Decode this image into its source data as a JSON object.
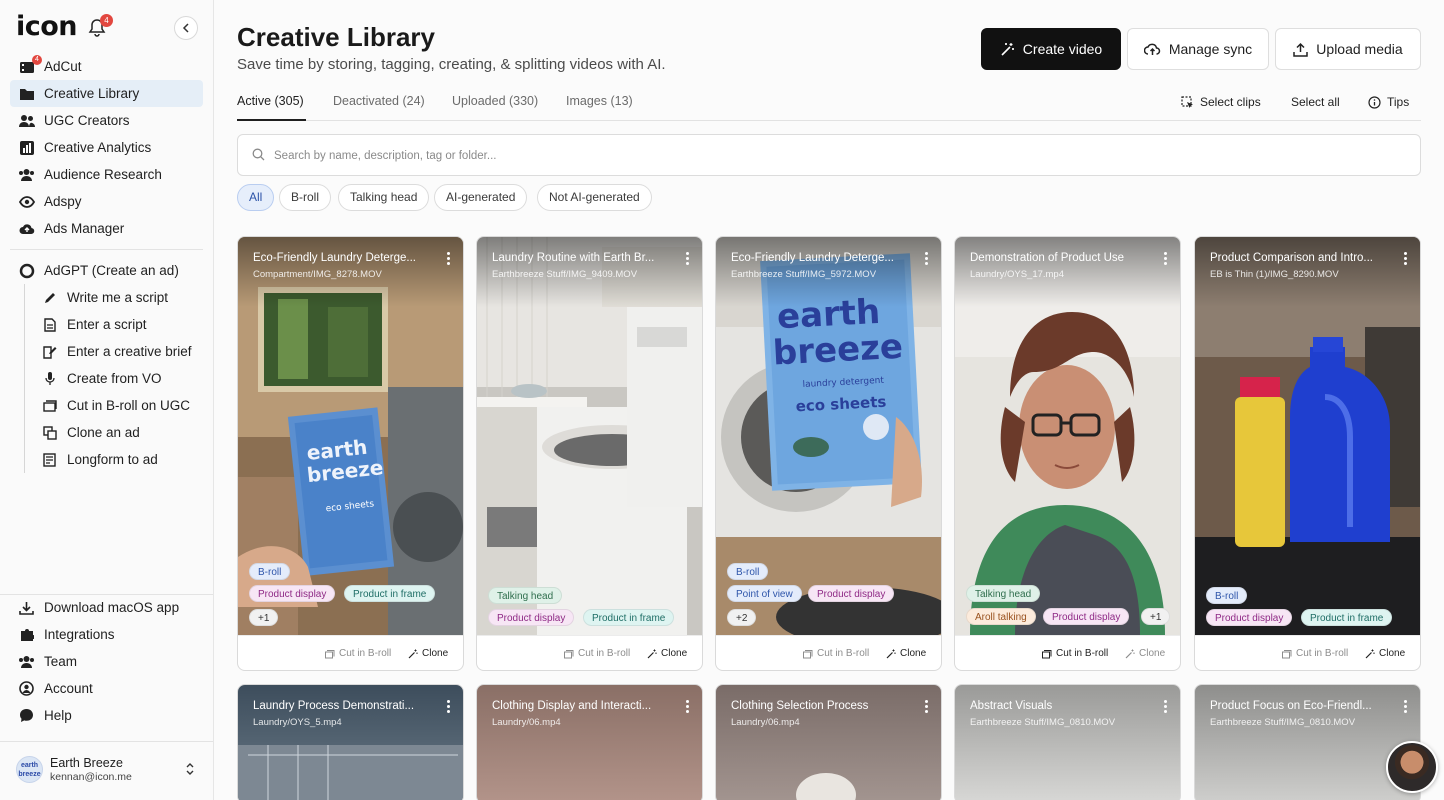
{
  "app": {
    "logo": "icon",
    "bell_badge": "4"
  },
  "sidebar": {
    "items": [
      {
        "label": "AdCut",
        "icon": "film-icon",
        "badge": "4"
      },
      {
        "label": "Creative Library",
        "icon": "folder-icon",
        "active": true
      },
      {
        "label": "UGC Creators",
        "icon": "users-icon"
      },
      {
        "label": "Creative Analytics",
        "icon": "bar-chart-icon"
      },
      {
        "label": "Audience Research",
        "icon": "audience-icon"
      },
      {
        "label": "Adspy",
        "icon": "eye-icon"
      },
      {
        "label": "Ads Manager",
        "icon": "cloud-upload-icon"
      }
    ],
    "adgpt": {
      "label": "AdGPT (Create an ad)",
      "icon": "ring-icon"
    },
    "sub_items": [
      {
        "label": "Write me a script",
        "icon": "pencil-icon"
      },
      {
        "label": "Enter a script",
        "icon": "document-icon"
      },
      {
        "label": "Enter a creative brief",
        "icon": "edit-doc-icon"
      },
      {
        "label": "Create from VO",
        "icon": "microphone-icon"
      },
      {
        "label": "Cut in B-roll on UGC",
        "icon": "media-stack-icon"
      },
      {
        "label": "Clone an ad",
        "icon": "copy-icon"
      },
      {
        "label": "Longform to ad",
        "icon": "longform-icon"
      }
    ],
    "bottom": [
      {
        "label": "Download macOS app",
        "icon": "download-icon"
      },
      {
        "label": "Integrations",
        "icon": "puzzle-icon"
      },
      {
        "label": "Team",
        "icon": "team-icon"
      },
      {
        "label": "Account",
        "icon": "account-icon"
      },
      {
        "label": "Help",
        "icon": "chat-icon"
      }
    ],
    "user": {
      "name": "Earth Breeze",
      "email": "kennan@icon.me",
      "avatar_text": "earth breeze"
    }
  },
  "header": {
    "title": "Creative Library",
    "subtitle": "Save time by storing, tagging, creating, & splitting videos with AI.",
    "buttons": {
      "create": "Create video",
      "sync": "Manage sync",
      "upload": "Upload media"
    }
  },
  "tabs": [
    "Active (305)",
    "Deactivated (24)",
    "Uploaded (330)",
    "Images (13)"
  ],
  "tools": {
    "select_clips": "Select clips",
    "select_all": "Select all",
    "tips": "Tips"
  },
  "search": {
    "placeholder": "Search by name, description, tag or folder..."
  },
  "filters": [
    "All",
    "B-roll",
    "Talking head",
    "AI-generated",
    "Not AI-generated"
  ],
  "cards": [
    {
      "title": "Eco-Friendly Laundry Deterge...",
      "path": "Compartment/IMG_8278.MOV",
      "tags": [
        [
          "B-roll"
        ],
        [
          "Product display",
          "Product in frame"
        ],
        [
          "+1"
        ]
      ],
      "cut_label": "Cut in B-roll",
      "clone_label": "Clone"
    },
    {
      "title": "Laundry Routine with Earth Br...",
      "path": "Earthbreeze Stuff/IMG_9409.MOV",
      "tags": [
        [
          "Talking head"
        ],
        [
          "Product display",
          "Product in frame"
        ]
      ],
      "cut_label": "Cut in B-roll",
      "clone_label": "Clone"
    },
    {
      "title": "Eco-Friendly Laundry Deterge...",
      "path": "Earthbreeze Stuff/IMG_5972.MOV",
      "product_box": {
        "line1": "earth",
        "line2": "breeze",
        "line3": "laundry detergent",
        "line4": "eco sheets"
      },
      "tags": [
        [
          "B-roll"
        ],
        [
          "Point of view",
          "Product display"
        ],
        [
          "+2"
        ]
      ],
      "cut_label": "Cut in B-roll",
      "clone_label": "Clone"
    },
    {
      "title": "Demonstration of Product Use",
      "path": "Laundry/OYS_17.mp4",
      "tags": [
        [
          "Talking head"
        ],
        [
          "Aroll talking",
          "Product display",
          "+1"
        ]
      ],
      "cut_label": "Cut in B-roll",
      "clone_label": "Clone"
    },
    {
      "title": "Product Comparison and Intro...",
      "path": "EB is Thin (1)/IMG_8290.MOV",
      "tags": [
        [
          "B-roll"
        ],
        [
          "Product display",
          "Product in frame"
        ]
      ],
      "cut_label": "Cut in B-roll",
      "clone_label": "Clone"
    }
  ],
  "cards_row2": [
    {
      "title": "Laundry Process Demonstrati...",
      "path": "Laundry/OYS_5.mp4"
    },
    {
      "title": "Clothing Display and Interacti...",
      "path": "Laundry/06.mp4"
    },
    {
      "title": "Clothing Selection Process",
      "path": "Laundry/06.mp4"
    },
    {
      "title": "Abstract Visuals",
      "path": "Earthbreeze Stuff/IMG_0810.MOV"
    },
    {
      "title": "Product Focus on Eco-Friendl...",
      "path": "Earthbreeze Stuff/IMG_0810.MOV"
    }
  ]
}
